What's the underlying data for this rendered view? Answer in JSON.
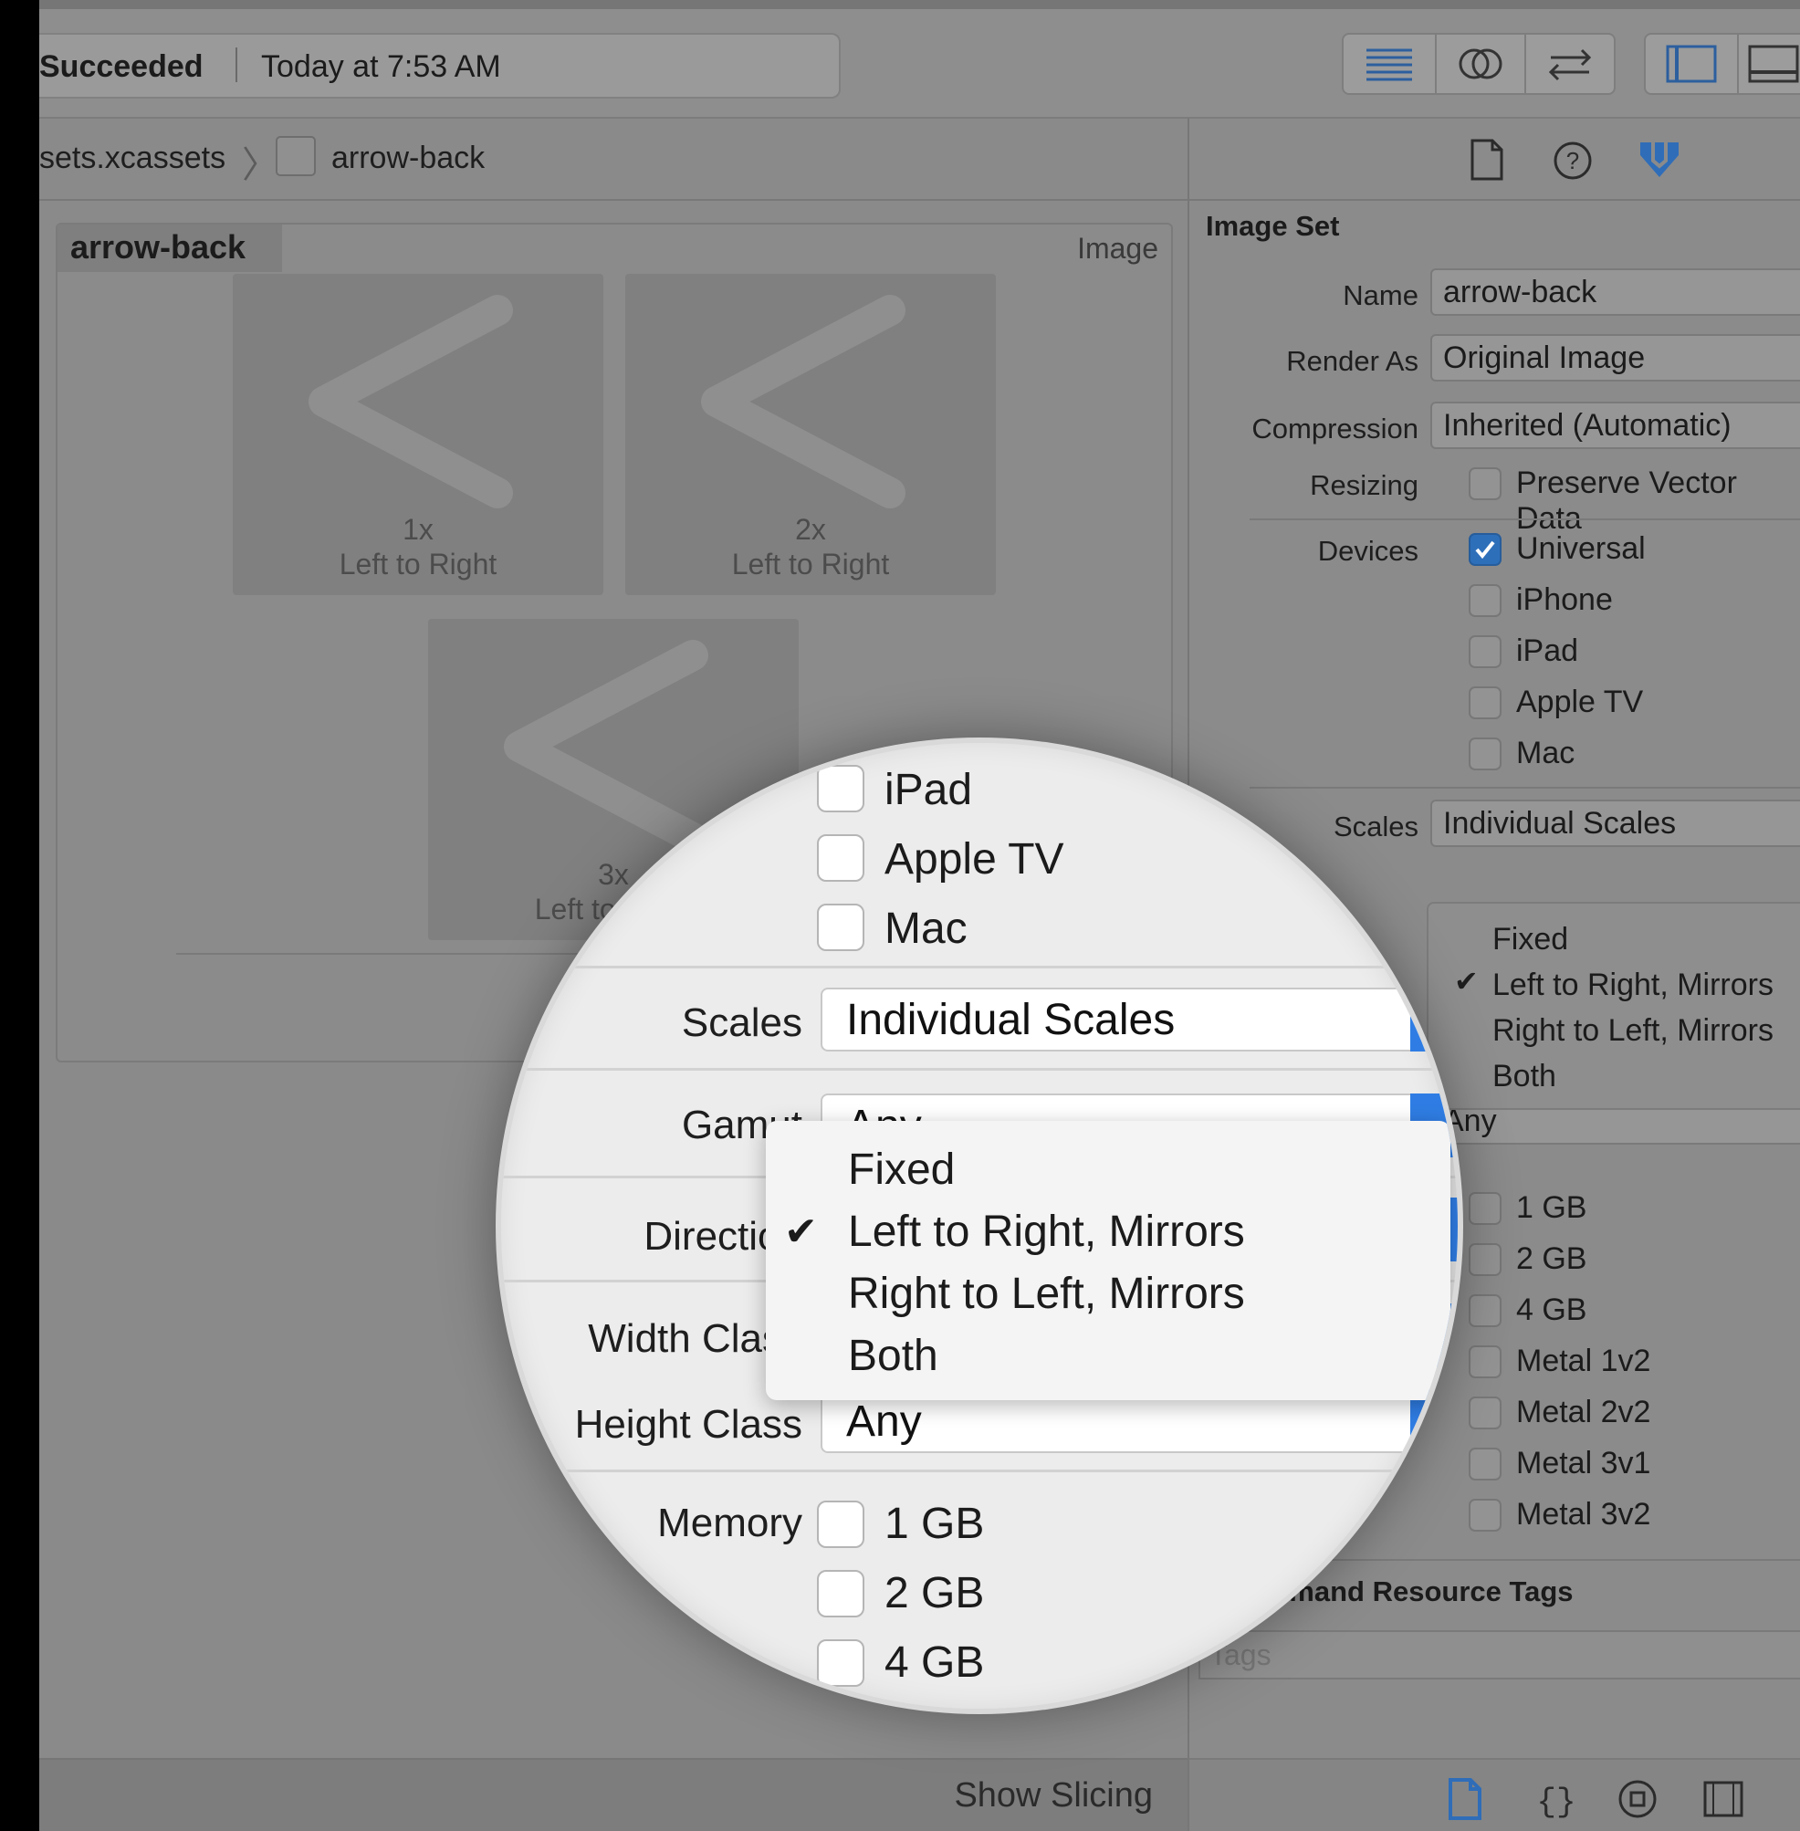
{
  "toolbar": {
    "status": "Succeeded",
    "time": "Today at 7:53 AM",
    "buttons": [
      {
        "icon": "standard-editor-icon"
      },
      {
        "icon": "assistant-editor-icon"
      },
      {
        "icon": "version-editor-icon"
      },
      {
        "icon": "navigator-toggle-icon"
      },
      {
        "icon": "debug-area-toggle-icon"
      }
    ]
  },
  "breadcrumb": {
    "catalog": "sets.xcassets",
    "asset": "arrow-back"
  },
  "image_set": {
    "name": "arrow-back",
    "type": "Image",
    "wells": [
      {
        "scale": "1x",
        "direction": "Left to Right"
      },
      {
        "scale": "2x",
        "direction": "Left to Right"
      },
      {
        "scale": "3x",
        "direction": "Left to Right"
      }
    ],
    "show_slicing": "Show Slicing"
  },
  "inspector": {
    "section_title": "Image Set",
    "name_label": "Name",
    "name_value": "arrow-back",
    "render_label": "Render As",
    "render_value": "Original Image",
    "compression_label": "Compression",
    "compression_value": "Inherited (Automatic)",
    "resizing_label": "Resizing",
    "preserve_vector": "Preserve Vector Data",
    "devices_label": "Devices",
    "devices": [
      {
        "label": "Universal",
        "checked": true
      },
      {
        "label": "iPhone",
        "checked": false
      },
      {
        "label": "iPad",
        "checked": false
      },
      {
        "label": "Apple TV",
        "checked": false
      },
      {
        "label": "Mac",
        "checked": false
      }
    ],
    "scales_label": "Scales",
    "scales_value": "Individual Scales",
    "gamut_label": "Gamut",
    "gamut_value": "Any",
    "height_value": "Any",
    "memory": [
      "1 GB",
      "2 GB",
      "4 GB"
    ],
    "metal": [
      "Metal 1v2",
      "Metal 2v2",
      "Metal 3v1",
      "Metal 3v2"
    ],
    "tags_title": "On Demand Resource Tags",
    "tags_placeholder": "Tags",
    "direction_menu": [
      "Fixed",
      "Left to Right, Mirrors",
      "Right to Left, Mirrors",
      "Both"
    ],
    "direction_selected": "Left to Right, Mirrors"
  },
  "magnifier": {
    "devices": [
      "iPad",
      "Apple TV",
      "Mac"
    ],
    "scales_label": "Scales",
    "scales_value": "Individual Scales",
    "gamut_label": "Gamut",
    "gamut_value": "Any",
    "direction_label": "Direction",
    "width_label": "Width Class",
    "height_label": "Height Class",
    "height_value": "Any",
    "memory_label": "Memory",
    "memory": [
      "1 GB",
      "2 GB",
      "4 GB"
    ],
    "menu": [
      "Fixed",
      "Left to Right, Mirrors",
      "Right to Left, Mirrors",
      "Both"
    ],
    "menu_selected_index": 1
  },
  "colors": {
    "accent": "#2f7de4",
    "dim_background": "#8b8b8b",
    "lens_background": "#ececec"
  }
}
